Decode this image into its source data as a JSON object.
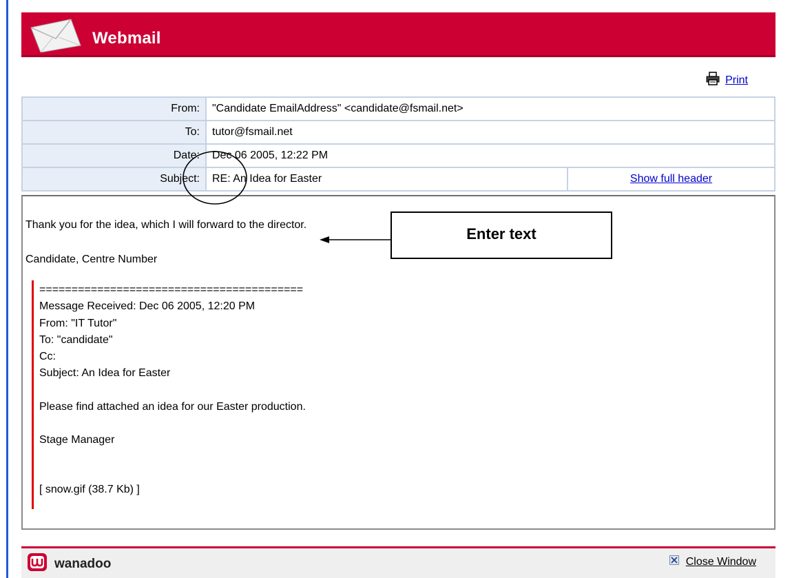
{
  "app": {
    "title": "Webmail",
    "brand": "wanadoo"
  },
  "colors": {
    "header": "#cc0033",
    "accent_blue": "#1f5bd6",
    "link": "#0000cc",
    "quote_bar": "#e00000",
    "label_bg": "#e8eef7"
  },
  "toolbar": {
    "print_label": "Print",
    "print_icon": "printer-icon"
  },
  "headers": {
    "from_label": "From:",
    "from_value": "\"Candidate EmailAddress\" <candidate@fsmail.net>",
    "to_label": "To:",
    "to_value": "tutor@fsmail.net",
    "date_label": "Date:",
    "date_value": "Dec 06 2005, 12:22 PM",
    "subject_label": "Subject:",
    "subject_value": "RE: An Idea for Easter",
    "show_full_header": "Show full header"
  },
  "body": {
    "line1": "Thank you for the idea, which I will forward to the director.",
    "line2": "Candidate, Centre Number"
  },
  "quoted": [
    "=========================================",
    "Message Received: Dec 06 2005, 12:20 PM",
    "From: \"IT Tutor\"",
    "To: \"candidate\"",
    "Cc:",
    "Subject: An Idea for Easter",
    "",
    "Please find attached an idea for our Easter production.",
    "",
    "Stage Manager",
    "",
    "",
    "[ snow.gif (38.7 Kb) ]"
  ],
  "annotation": {
    "callout_text": "Enter text"
  },
  "footer": {
    "close_label": "Close Window",
    "close_icon": "close-x-icon"
  }
}
